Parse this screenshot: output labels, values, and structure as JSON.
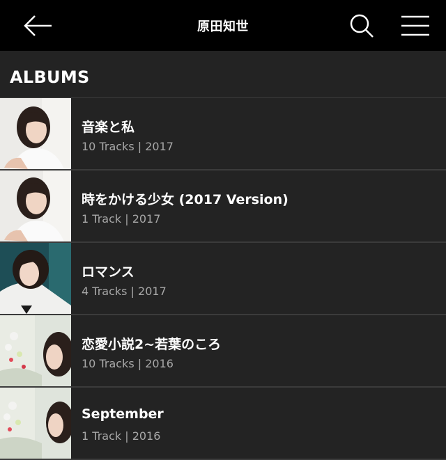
{
  "header": {
    "title": "原田知世",
    "back_icon": "arrow-left-icon",
    "search_icon": "search-icon",
    "menu_icon": "hamburger-menu-icon"
  },
  "section": {
    "title": "ALBUMS"
  },
  "albums": [
    {
      "title": "音楽と私",
      "meta": "10 Tracks | 2017"
    },
    {
      "title": "時をかける少女 (2017 Version)",
      "meta": "1 Track | 2017"
    },
    {
      "title": "ロマンス",
      "meta": "4 Tracks | 2017"
    },
    {
      "title": "恋愛小説2~若葉のころ",
      "meta": "10 Tracks | 2016"
    },
    {
      "title": "September",
      "meta": "1 Track | 2016"
    }
  ],
  "colors": {
    "topbar": "#000000",
    "background": "#232323",
    "divider": "#3b3b3b",
    "text": "#ffffff",
    "meta_text": "#a8a8a8"
  }
}
